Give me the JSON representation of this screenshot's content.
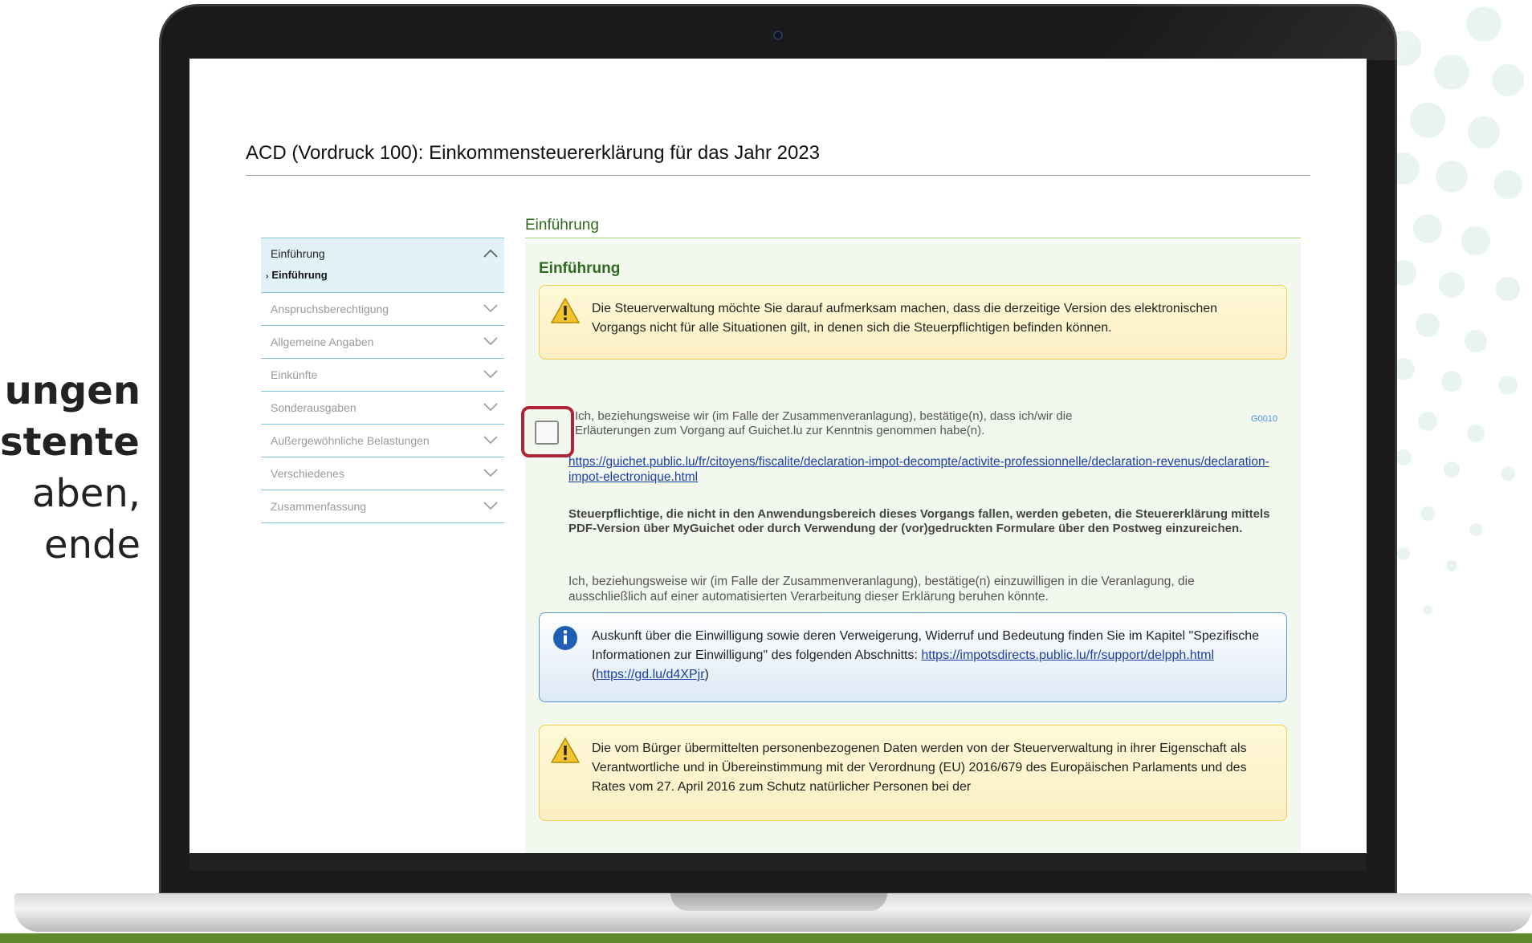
{
  "side_panel": {
    "line1": "ungen",
    "line2": "stenten",
    "line3": "aben,",
    "line4": "ende"
  },
  "window": {
    "title": "ACD (Vordruck 100): Einkommensteuererklärung für das Jahr 2023"
  },
  "sidebar": {
    "items": [
      {
        "label": "Einführung",
        "expanded": true,
        "sub": "Einführung"
      },
      {
        "label": "Anspruchsberechtigung"
      },
      {
        "label": "Allgemeine Angaben"
      },
      {
        "label": "Einkünfte"
      },
      {
        "label": "Sonderausgaben"
      },
      {
        "label": "Außergewöhnliche Belastungen"
      },
      {
        "label": "Verschiedenes"
      },
      {
        "label": "Zusammenfassung"
      }
    ]
  },
  "main": {
    "section_tab": "Einführung",
    "panel_title": "Einführung",
    "warning1": "Die Steuerverwaltung möchte Sie darauf aufmerksam machen, dass die derzeitige Version des elektronischen Vorgangs nicht für alle Situationen gilt, in denen sich die Steuerpflichtigen befinden können.",
    "checkbox_label": "Ich, beziehungsweise wir (im Falle der Zusammenveranlagung), bestätige(n), dass ich/wir die Erläuterungen zum Vorgang auf Guichet.lu zur Kenntnis genommen habe(n).",
    "checkbox_code": "G0010",
    "checkbox_checked": false,
    "guichet_link": "https://guichet.public.lu/fr/citoyens/fiscalite/declaration-impot-decompte/activite-professionnelle/declaration-revenus/declaration-impot-electronique.html",
    "bold_paragraph": "Steuerpflichtige, die nicht in den Anwendungsbereich dieses Vorgangs fallen, werden gebeten, die Steuererklärung mittels PDF-Version über MyGuichet oder durch Verwendung der (vor)gedruckten Formulare über den Postweg einzureichen.",
    "consent_paragraph": "Ich, beziehungsweise wir (im Falle der Zusammenveranlagung), bestätige(n) einzuwilligen in die Veranlagung, die ausschließlich auf einer automatisierten Verarbeitung dieser Erklärung beruhen könnte.",
    "info_text": "Auskunft über die Einwilligung sowie deren Verweigerung, Widerruf und Bedeutung finden Sie im Kapitel \"Spezifische Informationen zur Einwilligung\" des folgenden Abschnitts: ",
    "info_link1": "https://impotsdirects.public.lu/fr/support/delpph.html",
    "info_sep_open": " (",
    "info_link2": "https://gd.lu/d4XPjr",
    "info_sep_close": ")",
    "warning2": "Die vom Bürger übermittelten personenbezogenen Daten werden von der Steuerverwaltung in ihrer Eigenschaft als Verantwortliche und in Übereinstimmung mit der Verordnung (EU) 2016/679 des Europäischen Parlaments und des Rates vom 27. April 2016 zum Schutz natürlicher Personen bei der"
  },
  "colors": {
    "accent_green": "#2e6b1e",
    "nav_border": "#7fc3df",
    "highlight_red": "#b02437",
    "link_blue": "#1a3fa8",
    "bottom_strip": "#5e8a2c"
  }
}
